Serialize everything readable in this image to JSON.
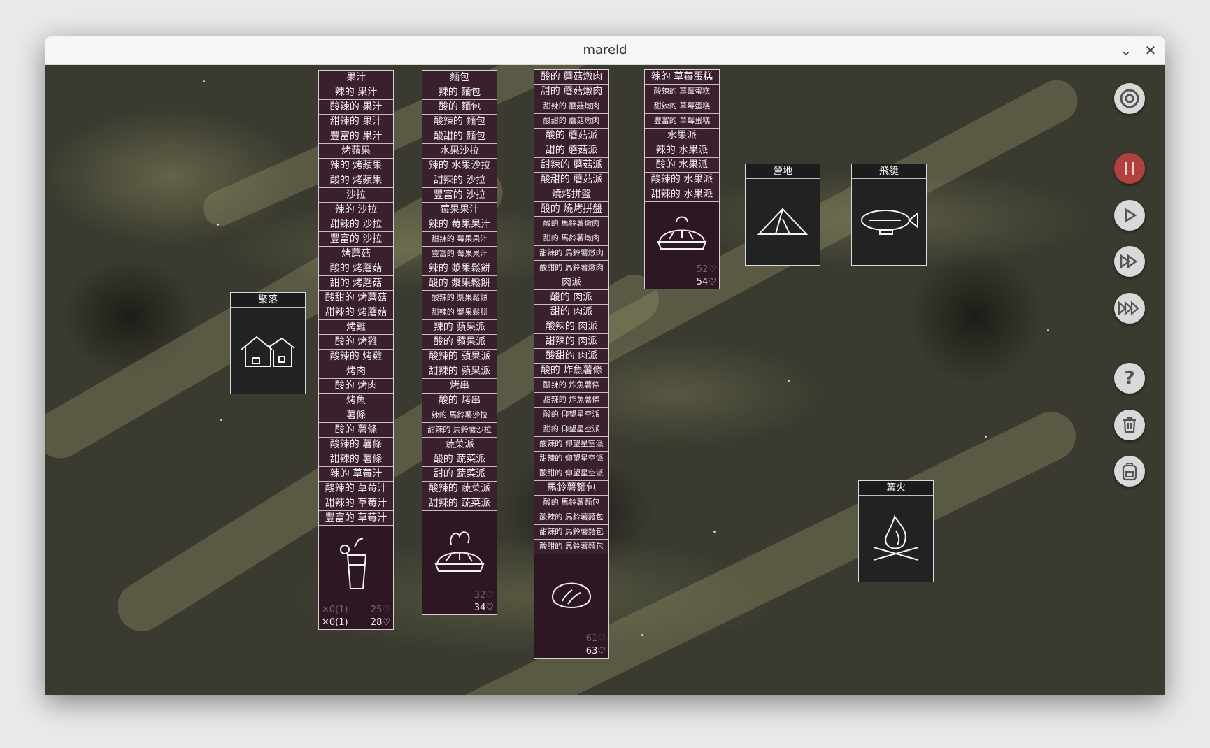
{
  "window": {
    "title": "mareld",
    "minimize_icon": "chevron-down-icon",
    "close_icon": "close-icon"
  },
  "stacks": {
    "juice": {
      "rows": [
        "果汁",
        "辣的 果汁",
        "酸辣的 果汁",
        "甜辣的 果汁",
        "豐富的 果汁",
        "烤蘋果",
        "辣的 烤蘋果",
        "酸的 烤蘋果",
        "沙拉",
        "辣的 沙拉",
        "甜辣的 沙拉",
        "豐富的 沙拉",
        "烤蘑菇",
        "酸的 烤蘑菇",
        "甜的 烤蘑菇",
        "酸甜的 烤蘑菇",
        "甜辣的 烤蘑菇",
        "烤雞",
        "酸的 烤雞",
        "酸辣的 烤雞",
        "烤肉",
        "酸的 烤肉",
        "烤魚",
        "薯條",
        "酸的 薯條",
        "酸辣的 薯條",
        "甜辣的 薯條",
        "辣的 草莓汁",
        "酸辣的 草莓汁",
        "甜辣的 草莓汁",
        "豐富的 草莓汁"
      ],
      "ghost_left": "✕0(1)",
      "ghost_right": "25♡",
      "left": "✕0(1)",
      "right": "28♡",
      "icon": "juice-glass-icon"
    },
    "bread": {
      "rows": [
        "麵包",
        "辣的 麵包",
        "酸的 麵包",
        "酸辣的 麵包",
        "酸甜的 麵包",
        "水果沙拉",
        "辣的 水果沙拉",
        "甜辣的 沙拉",
        "豐富的 沙拉",
        "莓果果汁",
        "辣的 莓果果汁",
        "甜辣的 莓果果汁",
        "豐富的 莓果果汁",
        "辣的 漿果鬆餅",
        "酸的 漿果鬆餅",
        "酸辣的 漿果鬆餅",
        "甜辣的 漿果鬆餅",
        "辣的 蘋果派",
        "酸的 蘋果派",
        "酸辣的 蘋果派",
        "甜辣的 蘋果派",
        "烤串",
        "酸的 烤串",
        "辣的 馬鈴薯沙拉",
        "甜辣的 馬鈴薯沙拉",
        "蔬菜派",
        "酸的 蔬菜派",
        "甜的 蔬菜派",
        "酸辣的 蔬菜派",
        "甜辣的 蔬菜派"
      ],
      "ghost_right": "32♡",
      "right": "34♡",
      "icon": "veggie-pie-icon"
    },
    "stew": {
      "rows": [
        "酸的 蘑菇燉肉",
        "甜的 蘑菇燉肉",
        "甜辣的 蘑菇燉肉",
        "酸甜的 蘑菇燉肉",
        "酸的 蘑菇派",
        "甜的 蘑菇派",
        "甜辣的 蘑菇派",
        "酸甜的 蘑菇派",
        "燒烤拼盤",
        "酸的 燒烤拼盤",
        "酸的 馬鈴薯燉肉",
        "甜的 馬鈴薯燉肉",
        "甜辣的 馬鈴薯燉肉",
        "酸甜的 馬鈴薯燉肉",
        "肉派",
        "酸的 肉派",
        "甜的 肉派",
        "酸辣的 肉派",
        "甜辣的 肉派",
        "酸甜的 肉派",
        "酸的 炸魚薯條",
        "酸辣的 炸魚薯條",
        "甜辣的 炸魚薯條",
        "酸的 仰望星空派",
        "甜的 仰望星空派",
        "酸辣的 仰望星空派",
        "甜辣的 仰望星空派",
        "酸甜的 仰望星空派",
        "馬鈴薯麵包",
        "酸的 馬鈴薯麵包",
        "酸辣的 馬鈴薯麵包",
        "甜辣的 馬鈴薯麵包",
        "酸甜的 馬鈴薯麵包"
      ],
      "ghost_right": "61♡",
      "right": "63♡",
      "icon": "bread-loaf-icon"
    },
    "cake": {
      "rows": [
        "辣的 草莓蛋糕",
        "酸辣的 草莓蛋糕",
        "甜辣的 草莓蛋糕",
        "豐富的 草莓蛋糕",
        "水果派",
        "辣的 水果派",
        "酸的 水果派",
        "酸辣的 水果派",
        "甜辣的 水果派"
      ],
      "ghost_right": "52♡",
      "right": "54♡",
      "icon": "fruit-pie-icon"
    }
  },
  "cards": {
    "village": {
      "title": "聚落",
      "icon": "houses-icon"
    },
    "camp": {
      "title": "營地",
      "icon": "tent-icon"
    },
    "airship": {
      "title": "飛艇",
      "icon": "airship-icon"
    },
    "bonfire": {
      "title": "篝火",
      "icon": "bonfire-icon"
    }
  },
  "sidebar": [
    "settings-icon",
    "pause-icon",
    "play-icon",
    "fast-forward-icon",
    "fastest-forward-icon",
    "help-icon",
    "trash-icon",
    "backpack-icon"
  ]
}
